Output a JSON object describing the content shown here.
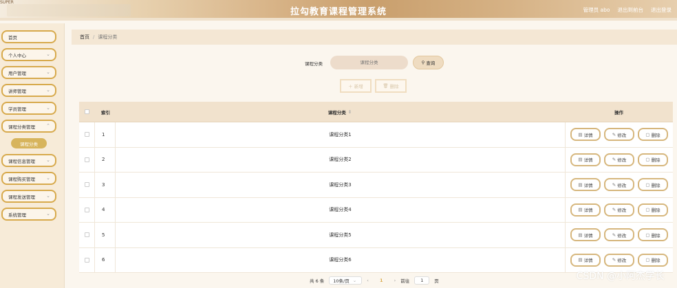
{
  "header": {
    "tag": "SUPER",
    "title": "拉勾教育课程管理系统",
    "links": [
      "管理员 abo",
      "退出到前台",
      "退出登录"
    ]
  },
  "sidebar": {
    "items": [
      {
        "label": "首页",
        "has_chevron": false
      },
      {
        "label": "个人中心",
        "has_chevron": true
      },
      {
        "label": "用户管理",
        "has_chevron": true
      },
      {
        "label": "讲师管理",
        "has_chevron": true
      },
      {
        "label": "学员管理",
        "has_chevron": true
      },
      {
        "label": "课程分类管理",
        "has_chevron": true
      },
      {
        "label": "课程信息管理",
        "has_chevron": true
      },
      {
        "label": "课程购买管理",
        "has_chevron": true
      },
      {
        "label": "课程发送管理",
        "has_chevron": true
      },
      {
        "label": "系统管理",
        "has_chevron": true
      }
    ],
    "active_submenu": "课程分类"
  },
  "breadcrumb": {
    "home": "首页",
    "current": "课程分类"
  },
  "search": {
    "label": "课程分类",
    "placeholder": "课程分类",
    "button": "查询"
  },
  "actions": {
    "add": "＋ 新增",
    "delete": "删除"
  },
  "table": {
    "headers": {
      "index": "索引",
      "name": "课程分类",
      "ops": "操作"
    },
    "rows": [
      {
        "index": "1",
        "name": "课程分类1"
      },
      {
        "index": "2",
        "name": "课程分类2"
      },
      {
        "index": "3",
        "name": "课程分类3"
      },
      {
        "index": "4",
        "name": "课程分类4"
      },
      {
        "index": "5",
        "name": "课程分类5"
      },
      {
        "index": "6",
        "name": "课程分类6"
      }
    ],
    "op_labels": {
      "detail": "详情",
      "edit": "修改",
      "delete": "删除"
    }
  },
  "pagination": {
    "total": "共 6 条",
    "page_size": "10条/页",
    "current_page": "1",
    "goto_label": "前往",
    "goto_value": "1",
    "page_suffix": "页"
  },
  "watermark": "CSDN @小阿杰学长",
  "colors": {
    "accent": "#d7a94b",
    "header_mid": "#c99f6d",
    "active_sub": "#d7b45c"
  }
}
